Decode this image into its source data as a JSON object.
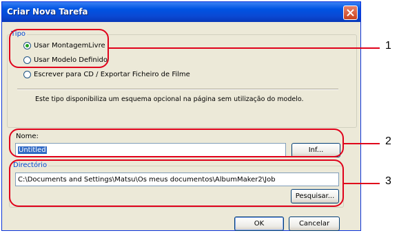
{
  "window": {
    "title": "Criar Nova Tarefa"
  },
  "tipo": {
    "group_label": "Tipo",
    "options": [
      {
        "label": "Usar MontagemLivre",
        "selected": true
      },
      {
        "label": "Usar Modelo Definido",
        "selected": false
      },
      {
        "label": "Escrever para CD / Exportar Ficheiro de Filme",
        "selected": false
      }
    ],
    "description": "Este tipo disponibiliza um esquema opcional na página sem utilização do modelo."
  },
  "nome": {
    "label": "Nome:",
    "value": "Untitled",
    "info_button": "Inf..."
  },
  "directorio": {
    "group_label": "Directório",
    "path": "C:\\Documents and Settings\\Matsu\\Os meus documentos\\AlbumMaker2\\Job",
    "browse_button": "Pesquisar..."
  },
  "footer": {
    "ok_label": "OK",
    "cancel_label": "Cancelar"
  },
  "callouts": [
    "1",
    "2",
    "3"
  ],
  "colors": {
    "callout": "#e0001a",
    "titlebar": "#0054e3",
    "dialog_bg": "#ece9d8",
    "group_label": "#0046d5"
  }
}
